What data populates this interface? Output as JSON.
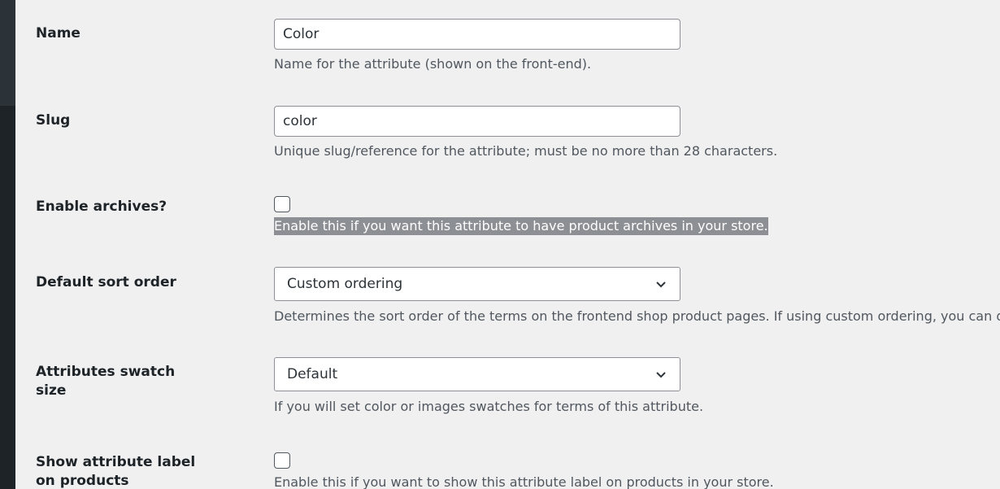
{
  "form": {
    "name": {
      "label": "Name",
      "value": "Color",
      "description": "Name for the attribute (shown on the front-end)."
    },
    "slug": {
      "label": "Slug",
      "value": "color",
      "description": "Unique slug/reference for the attribute; must be no more than 28 characters."
    },
    "enable_archives": {
      "label": "Enable archives?",
      "checked": false,
      "description": "Enable this if you want this attribute to have product archives in your store."
    },
    "default_sort_order": {
      "label": "Default sort order",
      "selected": "Custom ordering",
      "description": "Determines the sort order of the terms on the frontend shop product pages. If using custom ordering, you can drag"
    },
    "swatch_size": {
      "label": "Attributes swatch size",
      "selected": "Default",
      "description": "If you will set color or images swatches for terms of this attribute."
    },
    "show_label": {
      "label": "Show attribute label on products",
      "checked": false,
      "description": "Enable this if you want to show this attribute label on products in your store."
    }
  },
  "icons": {
    "select_arrow": "chevron-down-icon"
  },
  "colors": {
    "background": "#f0f0f1",
    "sidebar": "#1d2327",
    "text": "#1d2327",
    "description_text": "#50575e",
    "input_border": "#8c8f94",
    "selection_highlight": "#8c8f94"
  }
}
